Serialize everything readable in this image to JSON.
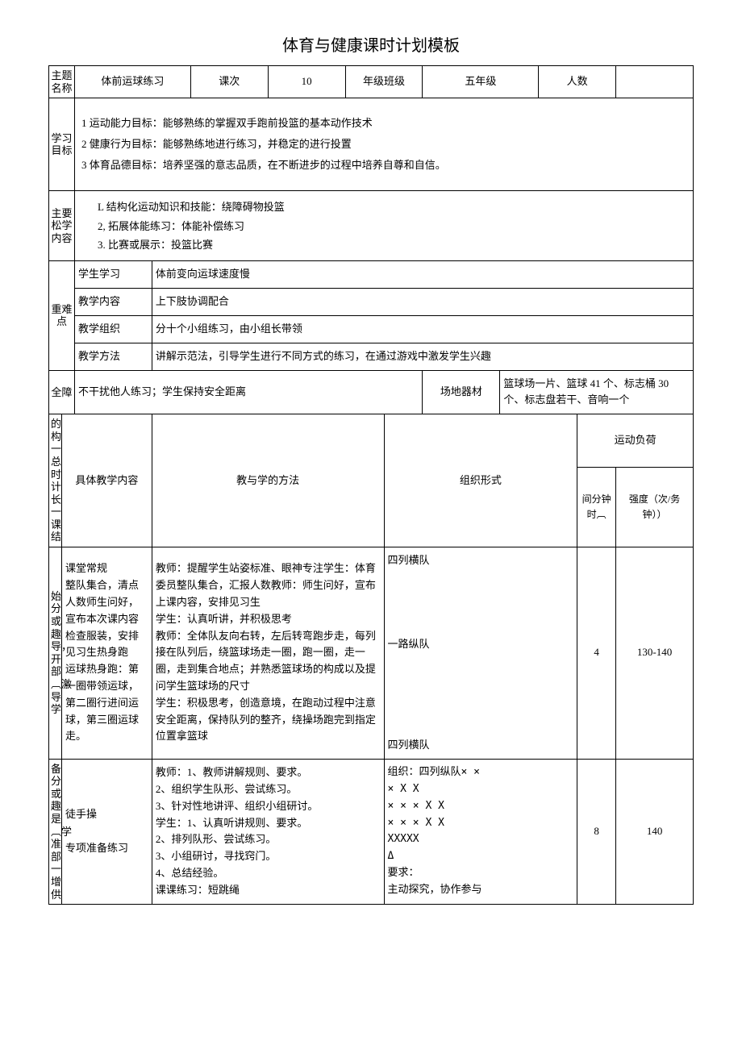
{
  "title": "体育与健康课时计划模板",
  "header": {
    "topic_label": "主题名称",
    "topic_value": "体前运球练习",
    "session_label": "课次",
    "session_value": "10",
    "grade_label": "年级班级",
    "grade_value": "五年级",
    "count_label": "人数",
    "count_value": ""
  },
  "goals": {
    "label": "学习目标",
    "line1": "1 运动能力目标：能够熟练的掌握双手跑前投篮的基本动作技术",
    "line2": "2 健康行为目标：能够熟练地进行练习，并稳定的进行投置",
    "line3": "3 体育品德目标：培养坚强的意志品质，在不断进步的过程中培养自尊和自信。"
  },
  "main_content": {
    "label": "主要松学内容",
    "line1": "L 结构化运动知识和技能：绕障碍物投篮",
    "line2": "2, 拓展体能练习：体能补偿练习",
    "line3": "3. 比赛或展示：投篮比赛"
  },
  "difficulty": {
    "label": "重难点",
    "rows": [
      {
        "k": "学生学习",
        "v": "体前变向运球速度慢"
      },
      {
        "k": "教学内容",
        "v": "上下肢协调配合"
      },
      {
        "k": "教学组织",
        "v": "分十个小组练习，由小组长带领"
      },
      {
        "k": "教学方法",
        "v": "讲解示范法，引导学生进行不同方式的练习，在通过游戏中激发学生兴趣"
      }
    ]
  },
  "safety": {
    "label": "全障",
    "value": "不干扰他人练习；学生保持安全距离",
    "equip_label": "场地器材",
    "equip_value": "篮球场一片、篮球 41 个、标志桶 30 个、标志盘若干、音响一个"
  },
  "table_head": {
    "structure_label": "的构一总时计长一课结",
    "content_label": "具体教学内容",
    "method_label": "教与学的方法",
    "org_label": "组织形式",
    "load_label": "运动负荷",
    "time_label": "间分钟时︹",
    "intensity_label": "强度（次/务钟））"
  },
  "rows": [
    {
      "phase": "始分或趣导，开部︹激导学",
      "content": "课堂常规\n整队集合，清点人数师生问好，宣布本次课内容检查服装，安排见习生热身跑\n运球热身跑：第一圈带领运球，第二圈行进间运球，第三圈运球走。",
      "method": "教师：提醒学生站姿标准、眼神专注学生：体育委员整队集合，汇报人数教师：师生问好，宣布上课内容，安排见习生\n学生：认真听讲，并积极思考\n教师：全体队友向右转，左后转弯跑步走，每列接在队列后，绕篮球场走一圈，跑一圈，走一圈，走到集合地点；并熟悉篮球场的构成以及提问学生篮球场的尺寸\n学生：积极思考，创造意境，在跑动过程中注意安全距离，保持队列的整齐，绕操场跑完到指定位置拿篮球",
      "org": "四列横队\n\n\n\n\n一路纵队\n\n\n\n\n\n四列横队",
      "time": "4",
      "intensity": "130-140"
    },
    {
      "phase": "备分或趣是︹学准部一增供",
      "content": "徒手操\n\n专项准备练习",
      "method": "教师：1、教师讲解规则、要求。\n2、组织学生队形、尝试练习。\n3、针对性地讲评、组织小组研讨。\n学生：1、认真听讲规则、要求。\n2、排列队形、尝试练习。\n3、小组研讨，寻找窍门。\n4、总结经验。\n课课练习：短跳绳",
      "org": "组织：四列纵队×          ×\n       × X  X\n×     × ×  X  X\n×      × ×  X  X\nXXXXX\n       Δ\n要求：\n主动探究，协作参与",
      "time": "8",
      "intensity": "140"
    }
  ]
}
